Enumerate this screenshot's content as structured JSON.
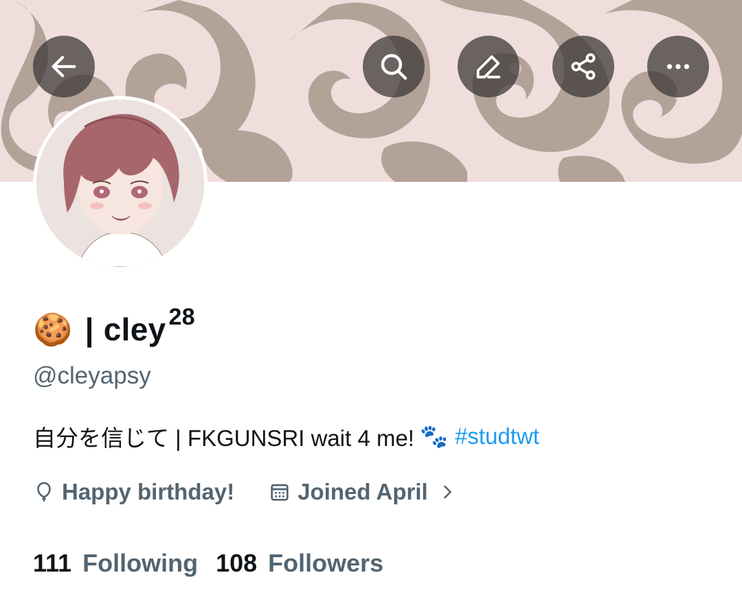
{
  "header": {
    "back_icon": "arrow-left-icon",
    "search_icon": "search-icon",
    "edit_icon": "pencil-icon",
    "share_icon": "share-icon",
    "more_icon": "more-horizontal-icon"
  },
  "profile": {
    "name_emoji": "🍪",
    "name_separator": "|",
    "name_text": "cley",
    "name_superscript": "28",
    "handle": "@cleyapsy",
    "bio_text": "自分を信じて | FKGUNSRI wait 4 me!",
    "bio_emoji": "🐾",
    "bio_hashtag": "#studtwt",
    "birthday_text": "Happy birthday!",
    "joined_text": "Joined April",
    "following_count": "111",
    "following_label": "Following",
    "followers_count": "108",
    "followers_label": "Followers"
  },
  "colors": {
    "accent": "#1d9bf0",
    "secondary_text": "#536471",
    "primary_text": "#0f1419",
    "banner_bg": "#f0dedd",
    "banner_pattern": "#b3a297",
    "button_bg": "#3c3737"
  }
}
